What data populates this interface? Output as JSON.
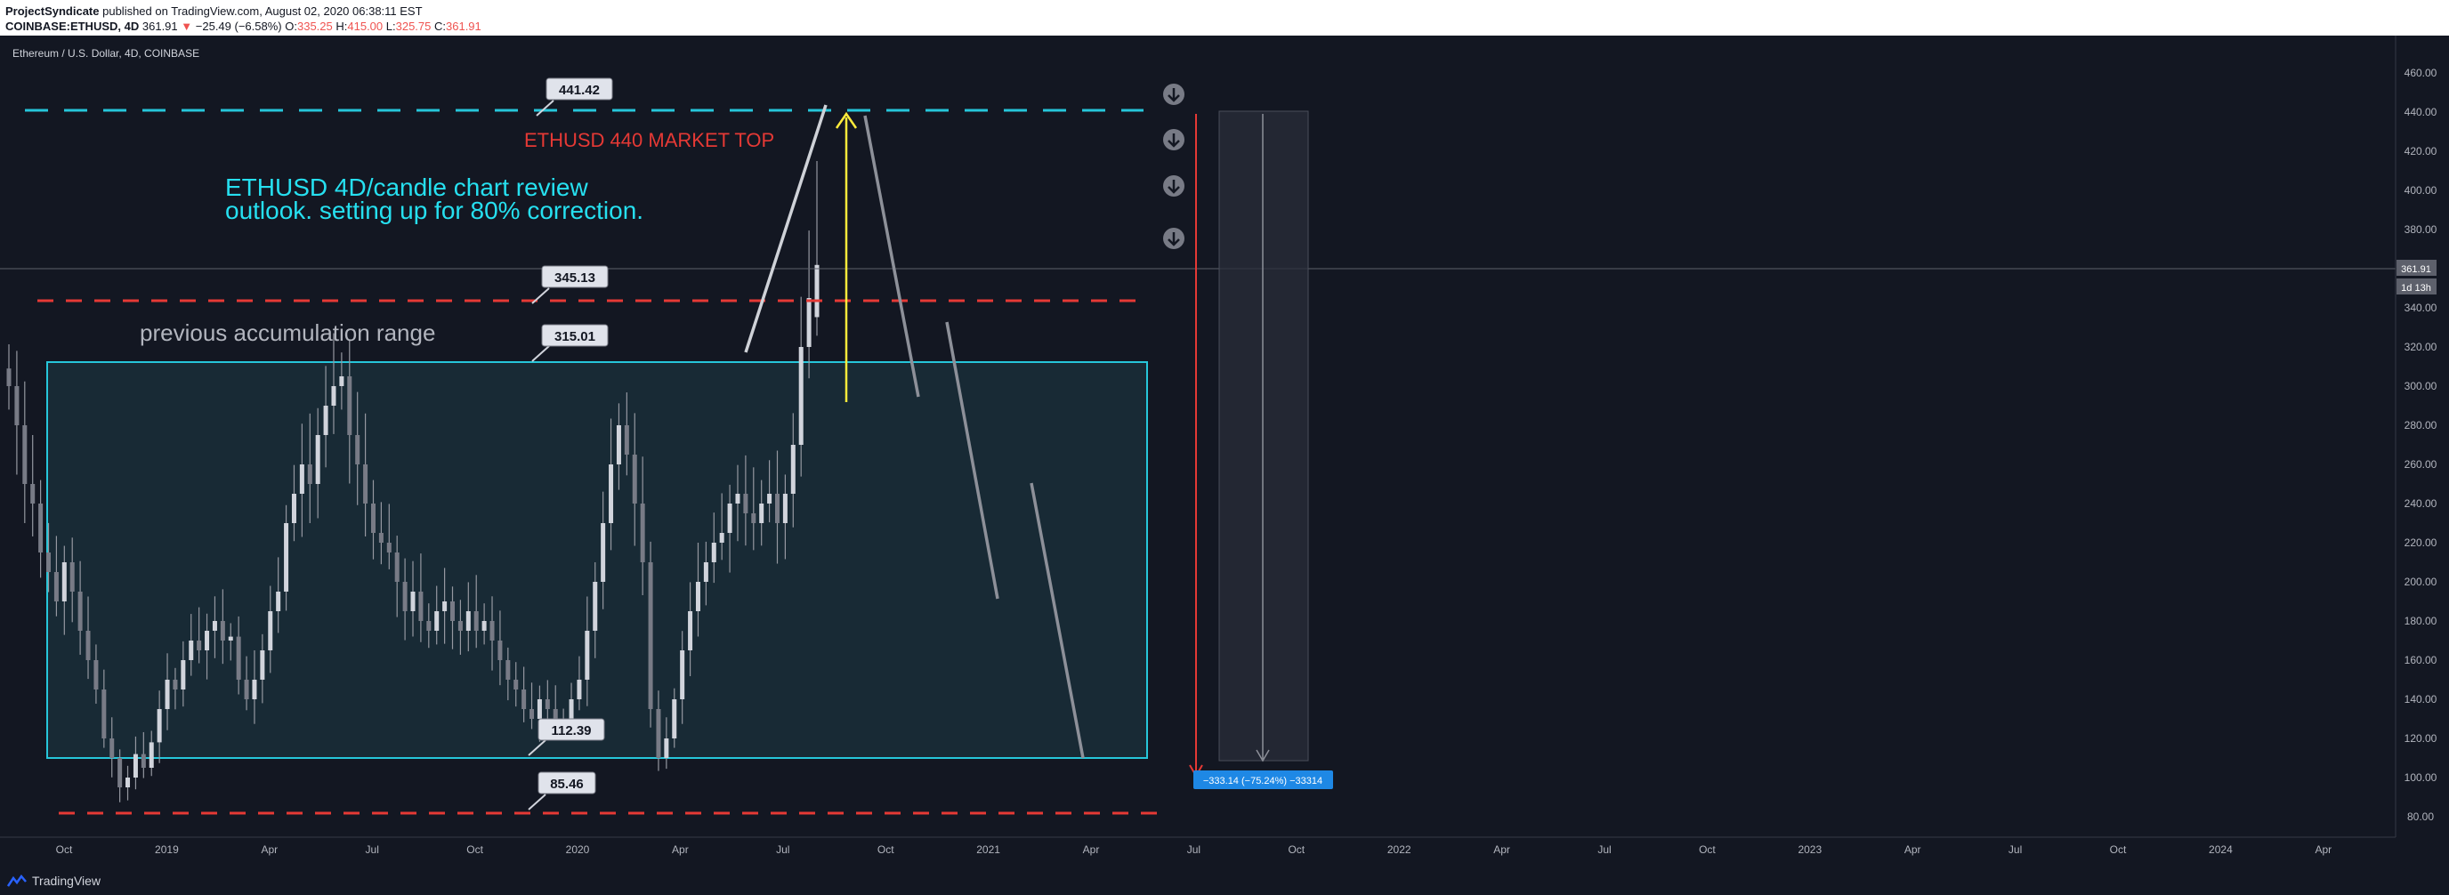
{
  "header": {
    "publisher": "ProjectSyndicate",
    "published_text": " published on TradingView.com, August 02, 2020 06:38:11 EST",
    "symbol": "COINBASE:ETHUSD, 4D",
    "price": "361.91",
    "change": "−25.49 (−6.58%)",
    "o_label": "O:",
    "o_value": "335.25",
    "h_label": "H:",
    "h_value": "415.00",
    "l_label": "L:",
    "l_value": "325.75",
    "c_label": "C:",
    "c_value": "361.91"
  },
  "chart_title": "Ethereum / U.S. Dollar, 4D, COINBASE",
  "annotations": {
    "market_top": "ETHUSD 440 MARKET TOP",
    "review_line1": "ETHUSD 4D/candle chart review",
    "review_line2": "outlook. setting up for 80% correction.",
    "range_label": "previous accumulation range",
    "measure_label": "−333.14 (−75.24%) −33314"
  },
  "price_labels": [
    "441.42",
    "345.13",
    "315.01",
    "112.39",
    "85.46"
  ],
  "current_price_tag": "361.91",
  "countdown_tag": "1d 13h",
  "footer": {
    "brand": "TradingView"
  },
  "colors": {
    "background": "#131722",
    "cyan": "#26c6da",
    "red_dash": "#e53935",
    "top_text": "#e53935",
    "review_text": "#26e0f0",
    "arrow_yellow": "#ffeb3b",
    "measure_blue": "#1e88e5"
  },
  "chart_data": {
    "type": "candlestick",
    "title": "Ethereum / U.S. Dollar, 4D, COINBASE",
    "ylim": [
      70,
      470
    ],
    "y_ticks": [
      80,
      100,
      120,
      140,
      160,
      180,
      200,
      220,
      240,
      260,
      280,
      300,
      320,
      340,
      360,
      380,
      400,
      420,
      440,
      460
    ],
    "x_ticks": [
      "Oct",
      "2019",
      "Apr",
      "Jul",
      "Oct",
      "2020",
      "Apr",
      "Jul",
      "Oct",
      "2021",
      "Apr",
      "Jul",
      "Oct",
      "2022",
      "Apr",
      "Jul",
      "Oct",
      "2023",
      "Apr",
      "Jul",
      "Oct",
      "2024",
      "Apr"
    ],
    "levels": [
      441.42,
      345.13,
      315.01,
      112.39,
      85.46
    ],
    "accumulation_range": [
      112.39,
      315.01
    ],
    "last_candle": {
      "open": 335.25,
      "high": 415.0,
      "low": 325.75,
      "close": 361.91
    },
    "measure": {
      "from": 441.42,
      "to": 108.28,
      "change": -333.14,
      "percent": -75.24
    },
    "approx_closes": [
      300,
      280,
      250,
      240,
      215,
      205,
      190,
      210,
      195,
      175,
      160,
      145,
      120,
      110,
      95,
      100,
      112,
      105,
      118,
      135,
      150,
      145,
      160,
      170,
      165,
      175,
      180,
      170,
      172,
      150,
      140,
      150,
      165,
      185,
      195,
      230,
      245,
      260,
      250,
      275,
      290,
      300,
      305,
      275,
      260,
      240,
      225,
      220,
      215,
      200,
      185,
      195,
      180,
      175,
      185,
      190,
      180,
      175,
      185,
      175,
      180,
      170,
      160,
      150,
      145,
      135,
      130,
      140,
      135,
      130,
      128,
      140,
      150,
      175,
      200,
      230,
      260,
      280,
      265,
      240,
      210,
      135,
      110,
      120,
      140,
      165,
      185,
      200,
      210,
      220,
      225,
      240,
      245,
      235,
      230,
      240,
      245,
      230,
      245,
      270,
      320,
      345,
      361.91
    ]
  }
}
